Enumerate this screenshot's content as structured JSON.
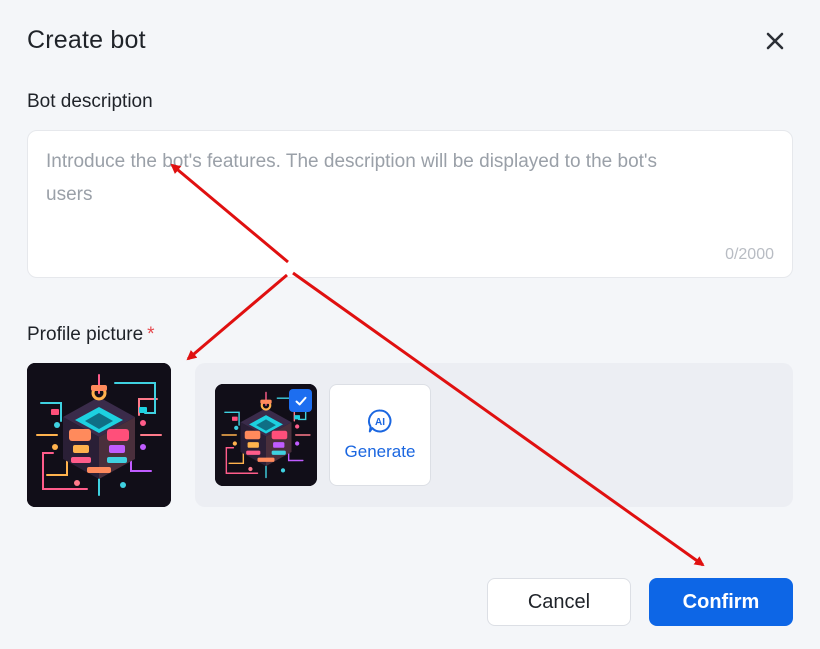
{
  "dialog": {
    "title": "Create bot",
    "close_icon": "close-icon"
  },
  "description": {
    "label": "Bot description",
    "value": "",
    "placeholder": "Introduce the bot's features. The description will be displayed to the bot's users",
    "counter": "0/2000"
  },
  "profile_picture": {
    "label": "Profile picture",
    "required_mark": "*",
    "selected_icon": "check-icon",
    "generate_icon": "ai-chat-icon",
    "generate_label": "Generate",
    "generate_badge": "AI"
  },
  "footer": {
    "cancel_label": "Cancel",
    "confirm_label": "Confirm"
  },
  "colors": {
    "accent": "#0d66e6",
    "required": "#e5484d",
    "annotation_arrow": "#e01010",
    "background": "#f4f6f9"
  }
}
